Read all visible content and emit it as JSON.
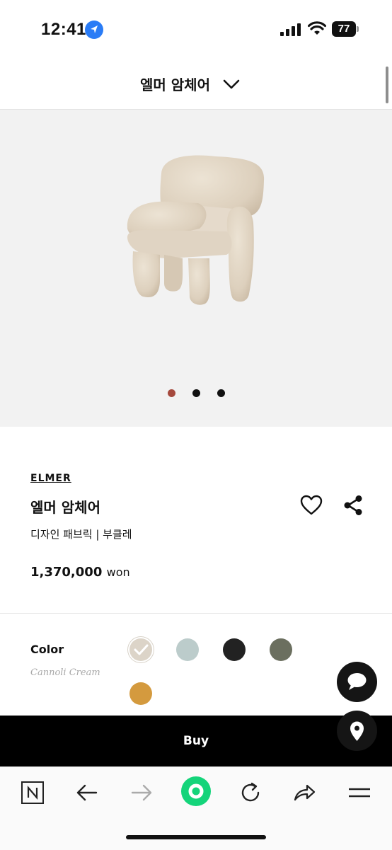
{
  "status_bar": {
    "time": "12:41",
    "battery": "77"
  },
  "header": {
    "title": "엘머 암체어"
  },
  "gallery": {
    "dot_count": 3,
    "active_index": 0
  },
  "product": {
    "brand": "ELMER",
    "name": "엘머 암체어",
    "description": "디자인 패브릭 | 부클레",
    "price": "1,370,000",
    "currency": "won"
  },
  "color": {
    "label": "Color",
    "selected_name": "Cannoli Cream",
    "swatches": [
      "#dcd4c8",
      "#bccccb",
      "#222222",
      "#6b6f5f",
      "#d49a3e"
    ]
  },
  "actions": {
    "buy_label": "Buy"
  },
  "browser_toolbar": {
    "items": [
      "naver-home-icon",
      "back-arrow-icon",
      "forward-arrow-icon",
      "green-dot-home-icon",
      "reload-icon",
      "share-arrow-icon",
      "menu-icon"
    ]
  }
}
